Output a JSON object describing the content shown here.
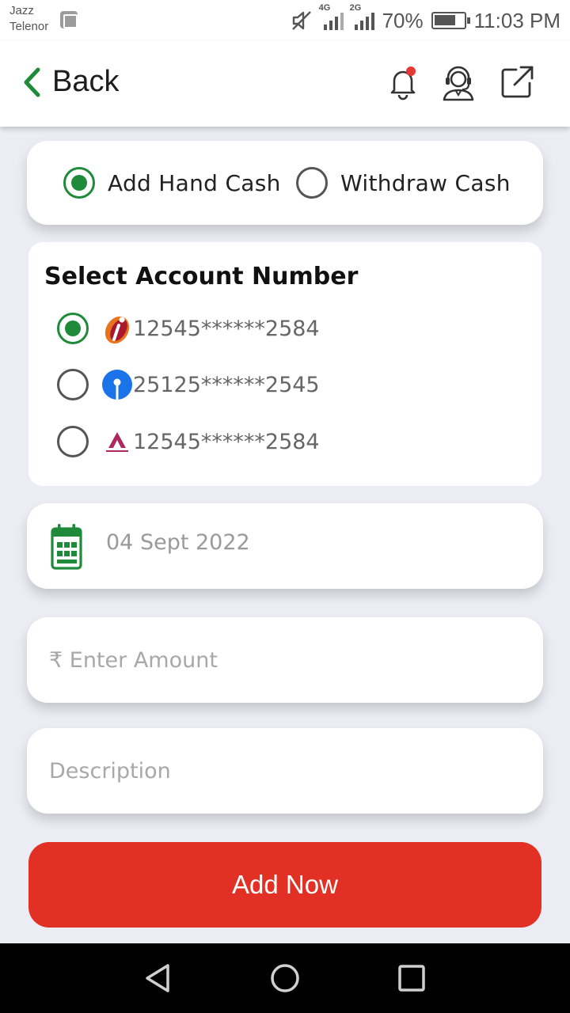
{
  "status_bar": {
    "carrier_1": "Jazz",
    "carrier_2": "Telenor",
    "net_1": "4G",
    "net_2": "2G",
    "battery": "70%",
    "time": "11:03 PM"
  },
  "header": {
    "back_label": "Back",
    "notification_dot_color": "#e53935",
    "accent_color": "#1e8a3a"
  },
  "cash_type": {
    "options": [
      {
        "label": "Add Hand Cash",
        "selected": true
      },
      {
        "label": "Withdraw Cash",
        "selected": false
      }
    ]
  },
  "accounts": {
    "title": "Select Account Number",
    "items": [
      {
        "bank_icon": "icici-bank-logo",
        "number": "12545******2584",
        "selected": true
      },
      {
        "bank_icon": "sbi-bank-logo",
        "number": "25125******2545",
        "selected": false
      },
      {
        "bank_icon": "axis-bank-logo",
        "number": "12545******2584",
        "selected": false
      }
    ]
  },
  "date_field": {
    "icon": "calendar-icon",
    "value": "04 Sept 2022"
  },
  "amount_field": {
    "placeholder": "₹ Enter Amount",
    "value": ""
  },
  "description_field": {
    "placeholder": "Description",
    "value": ""
  },
  "submit": {
    "label": "Add Now",
    "color": "#e23024"
  }
}
